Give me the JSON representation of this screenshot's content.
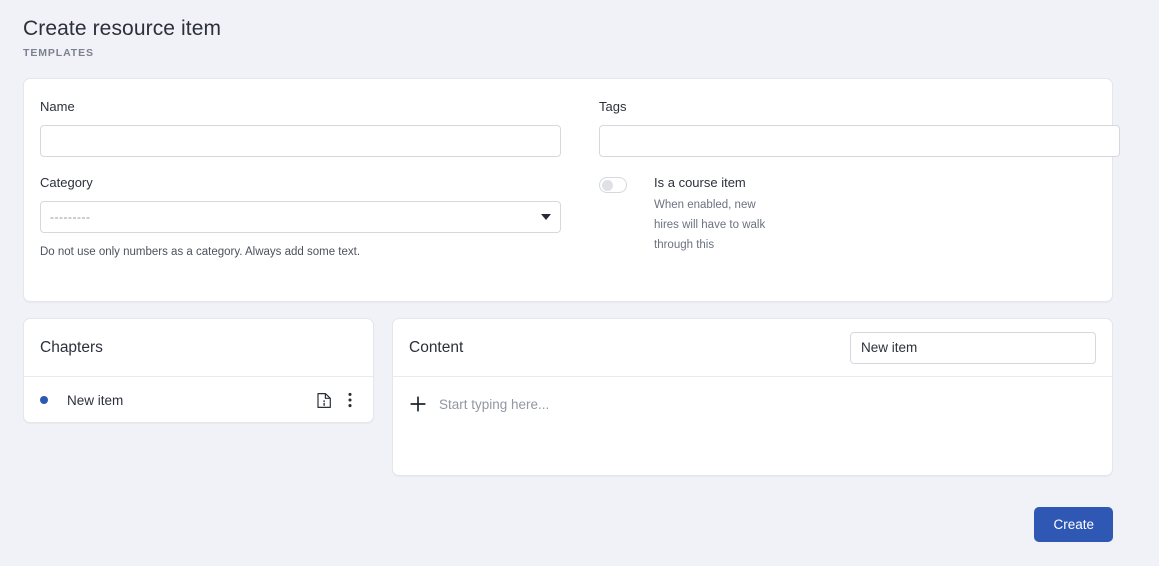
{
  "header": {
    "title": "Create resource item",
    "eyebrow": "TEMPLATES"
  },
  "form": {
    "name": {
      "label": "Name",
      "value": "",
      "placeholder": ""
    },
    "tags": {
      "label": "Tags",
      "value": "",
      "placeholder": ""
    },
    "category": {
      "label": "Category",
      "selected": "---------",
      "help": "Do not use only numbers as a category. Always add some text."
    },
    "course_toggle": {
      "label": "Is a course item",
      "help": "When enabled, new hires will have to walk through this",
      "state": "off"
    }
  },
  "chapters": {
    "title": "Chapters",
    "items": [
      {
        "label": "New item",
        "bullet_color": "#2f58b5",
        "preview_icon": "file-info-icon",
        "menu_icon": "more-vertical-icon"
      }
    ]
  },
  "content": {
    "title": "Content",
    "title_input_value": "New item",
    "title_input_placeholder": "",
    "editor_placeholder": "Start typing here...",
    "add_icon": "plus-icon"
  },
  "footer": {
    "create_label": "Create",
    "create_color": "#2f58b5"
  }
}
